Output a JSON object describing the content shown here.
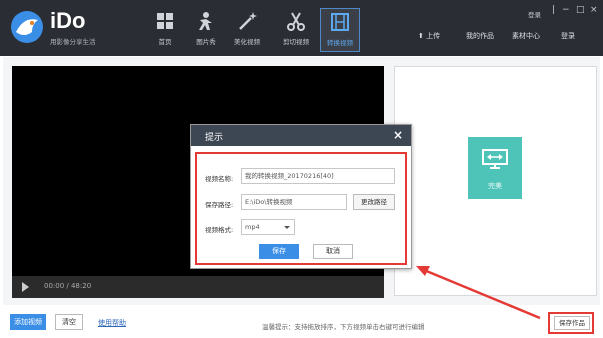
{
  "app": {
    "brand": "iDo",
    "tagline": "用影像分享生活"
  },
  "nav": [
    {
      "label": "首页",
      "icon": "grid-icon"
    },
    {
      "label": "图片秀",
      "icon": "sparkle-person-icon"
    },
    {
      "label": "美化视频",
      "icon": "magic-wand-icon"
    },
    {
      "label": "剪切视频",
      "icon": "scissors-icon"
    },
    {
      "label": "转换视频",
      "icon": "film-strip-icon",
      "active": true
    }
  ],
  "window": {
    "user_link": "登录",
    "controls": [
      "|",
      "−",
      "□",
      "×"
    ]
  },
  "right_nav": {
    "upload": "上传",
    "my_works": "我的作品",
    "material_center": "素材中心",
    "login": "登录"
  },
  "player": {
    "time": "00:00 / 48:20"
  },
  "side": {
    "tile_label": "完美"
  },
  "bottombar": {
    "add_video": "添加视频",
    "clear": "清空",
    "help": "使用帮助",
    "tip": "温馨提示：支持拖放排序，下方视频单击右键可进行编辑",
    "save_work": "保存作品"
  },
  "dialog": {
    "title": "提示",
    "close": "×",
    "name_label": "视频名称:",
    "name_value": "我的转换视频_20170216[40]",
    "path_label": "保存路径:",
    "path_value": "E:\\iDo\\转换视频",
    "change_path": "更改路径",
    "format_label": "视频格式:",
    "format_value": "mp4",
    "save": "保存",
    "cancel": "取消"
  },
  "colors": {
    "topbar": "#2a2d33",
    "accent_blue": "#3a8ee6",
    "highlight_red": "#e53935",
    "tile_teal": "#4ec3b7"
  }
}
